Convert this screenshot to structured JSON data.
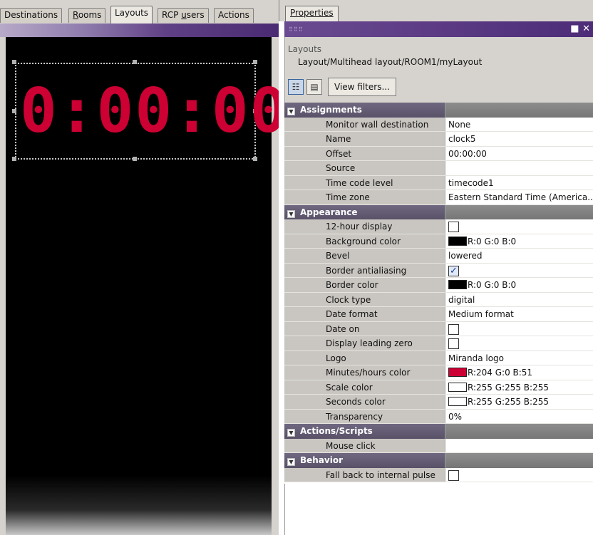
{
  "left_tabs": [
    {
      "label": "Destinations"
    },
    {
      "label": "Rooms",
      "underline": "R",
      "rest": "ooms"
    },
    {
      "label": "Layouts"
    },
    {
      "label": "RCP users",
      "pre": "RCP ",
      "underline": "u",
      "rest": "sers"
    },
    {
      "label": "Actions"
    }
  ],
  "clock": {
    "display": "0:00:00",
    "color": "#cc0033"
  },
  "properties_tab": "Properties",
  "window_buttons": "■ ✕",
  "header": {
    "title": "Layouts",
    "path": "Layout/Multihead layout/ROOM1/myLayout",
    "view_filters_label": "View filters..."
  },
  "sections": [
    {
      "name": "Assignments",
      "rows": [
        {
          "label": "Monitor wall destination",
          "value": "None"
        },
        {
          "label": "Name",
          "value": "clock5"
        },
        {
          "label": "Offset",
          "value": "00:00:00"
        },
        {
          "label": "Source",
          "value": ""
        },
        {
          "label": "Time code level",
          "value": "timecode1"
        },
        {
          "label": "Time zone",
          "value": "Eastern Standard Time (America..."
        }
      ]
    },
    {
      "name": "Appearance",
      "rows": [
        {
          "label": "12-hour display",
          "checkbox": false
        },
        {
          "label": "Background color",
          "swatch": "#000000",
          "value": "R:0 G:0 B:0"
        },
        {
          "label": "Bevel",
          "value": "lowered"
        },
        {
          "label": "Border antialiasing",
          "checkbox": true
        },
        {
          "label": "Border color",
          "swatch": "#000000",
          "value": "R:0 G:0 B:0"
        },
        {
          "label": "Clock type",
          "value": "digital"
        },
        {
          "label": "Date format",
          "value": "Medium format"
        },
        {
          "label": "Date on",
          "checkbox": false
        },
        {
          "label": "Display leading zero",
          "checkbox": false
        },
        {
          "label": "Logo",
          "value": "Miranda logo"
        },
        {
          "label": "Minutes/hours color",
          "swatch": "#cc0033",
          "value": "R:204 G:0 B:51"
        },
        {
          "label": "Scale color",
          "swatch": "#ffffff",
          "value": "R:255 G:255 B:255"
        },
        {
          "label": "Seconds color",
          "swatch": "#ffffff",
          "value": "R:255 G:255 B:255"
        },
        {
          "label": "Transparency",
          "value": "0%"
        }
      ]
    },
    {
      "name": "Actions/Scripts",
      "rows": [
        {
          "label": "Mouse click",
          "value": ""
        }
      ]
    },
    {
      "name": "Behavior",
      "rows": [
        {
          "label": "Fall back to internal pulse",
          "checkbox": false
        }
      ]
    }
  ]
}
